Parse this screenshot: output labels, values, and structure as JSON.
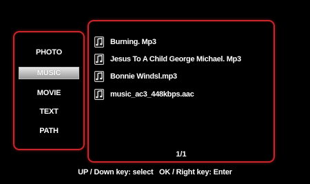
{
  "menu": {
    "items": [
      {
        "label": "PHOTO"
      },
      {
        "label": "MUSIC"
      },
      {
        "label": "MOVIE"
      },
      {
        "label": "TEXT"
      },
      {
        "label": "PATH"
      }
    ],
    "selected": "MUSIC"
  },
  "files": {
    "items": [
      {
        "name": "Burning. Mp3",
        "icon": "music-file-icon"
      },
      {
        "name": "Jesus To A Child George Michael. Mp3",
        "icon": "music-file-icon"
      },
      {
        "name": "Bonnie Windsl.mp3",
        "icon": "music-file-icon"
      },
      {
        "name": "music_ac3_448kbps.aac",
        "icon": "music-file-icon"
      }
    ],
    "page_indicator": "1/1"
  },
  "help": {
    "text": "UP / Down key: select   OK / Right key: Enter"
  },
  "colors": {
    "background": "#000000",
    "border": "#c8262b",
    "text": "#ffffff",
    "selected_bg": "#b0b0b0"
  }
}
